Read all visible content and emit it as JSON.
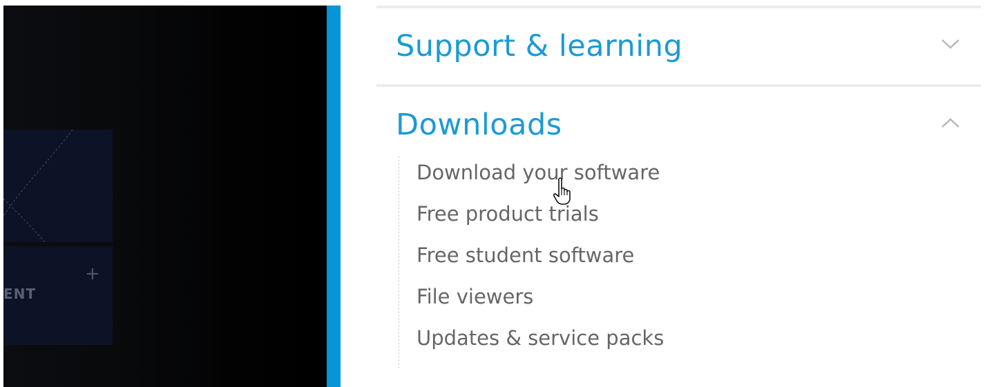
{
  "left_panel": {
    "card_label": "ENT",
    "plus_icon": "+"
  },
  "menu": {
    "sections": [
      {
        "title": "Support & learning",
        "expanded": false,
        "chevron": "chevron-down-icon"
      },
      {
        "title": "Downloads",
        "expanded": true,
        "chevron": "chevron-up-icon",
        "links": [
          "Download your software",
          "Free product trials",
          "Free student software",
          "File viewers",
          "Updates & service packs"
        ]
      }
    ]
  },
  "colors": {
    "accent": "#1b9ad6",
    "blue_bar": "#0696d7",
    "link_text": "#666666",
    "divider": "#ececec"
  },
  "cursor": "hand-pointer-icon"
}
